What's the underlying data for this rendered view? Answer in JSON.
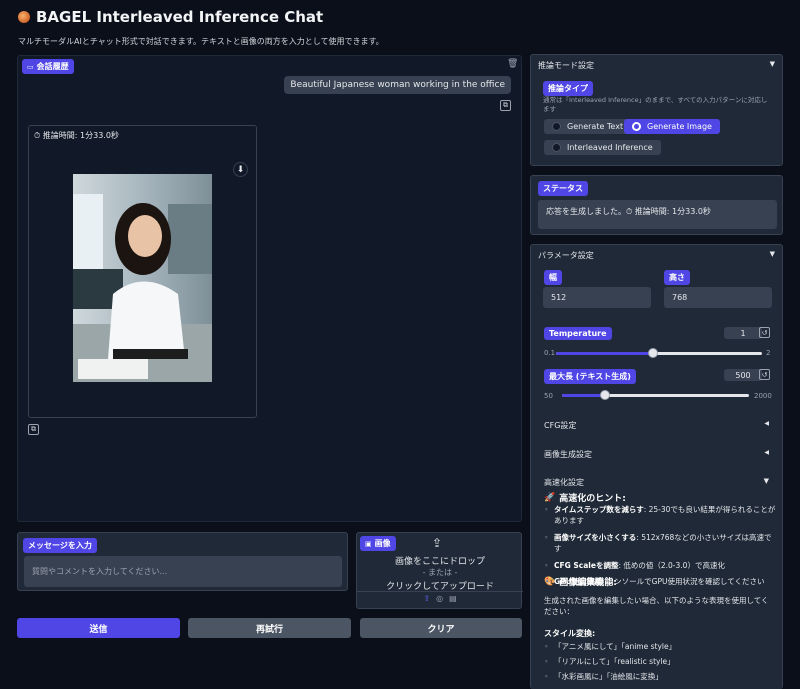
{
  "app": {
    "title": "BAGEL Interleaved Inference Chat",
    "subtitle": "マルチモーダルAIとチャット形式で対話できます。テキストと画像の両方を入力として使用できます。"
  },
  "chat": {
    "label": "会話履歴",
    "user_message": "Beautiful Japanese woman working in the office",
    "response_time": "⏱ 推論時間: 1分33.0秒"
  },
  "input": {
    "label": "メッセージを入力",
    "placeholder": "質問やコメントを入力してください..."
  },
  "image_upload": {
    "label": "画像",
    "drop_text": "画像をここにドロップ",
    "or_text": "- または -",
    "click_text": "クリックしてアップロード"
  },
  "actions": {
    "send": "送信",
    "retry": "再試行",
    "clear": "クリア"
  },
  "inference_mode": {
    "header": "推論モード設定",
    "label": "推論タイプ",
    "description": "通常は「Interleaved Inference」のままで、すべての入力パターンに対応します",
    "options": [
      "Generate Text",
      "Generate Image",
      "Interleaved Inference"
    ],
    "selected": "Generate Image"
  },
  "status": {
    "label": "ステータス",
    "text": "応答を生成しました。⏱ 推論時間: 1分33.0秒"
  },
  "params": {
    "header": "パラメータ設定",
    "width_label": "幅",
    "width_value": "512",
    "height_label": "高さ",
    "height_value": "768",
    "temperature": {
      "label": "Temperature",
      "value": "1",
      "min": "0.1",
      "max": "2",
      "fraction": 0.47
    },
    "max_length": {
      "label": "最大長 (テキスト生成)",
      "value": "500",
      "min": "50",
      "max": "2000",
      "fraction": 0.23
    },
    "cfg": "CFG設定",
    "image_gen": "画像生成設定",
    "speed": "高速化設定"
  },
  "hints": {
    "title": "高速化のヒント:",
    "items": [
      {
        "bold": "タイムステップ数を減らす",
        "text": ": 25-30でも良い結果が得られることがあります"
      },
      {
        "bold": "画像サイズを小さくする",
        "text": ": 512x768などの小さいサイズは高速です"
      },
      {
        "bold": "CFG Scaleを調整",
        "text": ": 低めの値（2.0-3.0）で高速化"
      },
      {
        "bold": "GPU使用確認",
        "text": ": コンソールでGPU使用状況を確認してください"
      }
    ]
  },
  "edit": {
    "title": "画像編集機能:",
    "description": "生成された画像を編集したい場合、以下のような表現を使用してください：",
    "style_title": "スタイル変換:",
    "items": [
      "「アニメ風にして」「anime style」",
      "「リアルにして」「realistic style」",
      "「水彩画風に」「油絵風に変換」"
    ]
  },
  "colors": {
    "background": "#0b0f19",
    "panel": "#1f2937",
    "accent": "#4f46e5"
  }
}
